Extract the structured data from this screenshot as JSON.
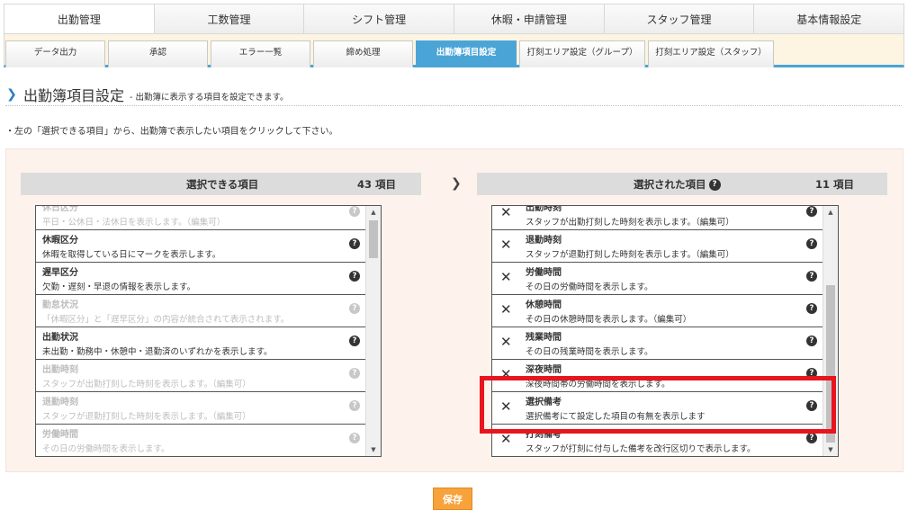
{
  "main_nav": [
    {
      "label": "出勤管理",
      "active": true
    },
    {
      "label": "工数管理"
    },
    {
      "label": "シフト管理"
    },
    {
      "label": "休暇・申請管理"
    },
    {
      "label": "スタッフ管理"
    },
    {
      "label": "基本情報設定"
    }
  ],
  "sub_nav": [
    {
      "label": "データ出力"
    },
    {
      "label": "承認"
    },
    {
      "label": "エラー一覧"
    },
    {
      "label": "締め処理"
    },
    {
      "label": "出勤簿項目設定",
      "active": true
    },
    {
      "label": "打刻エリア設定（グループ）"
    },
    {
      "label": "打刻エリア設定（スタッフ）"
    }
  ],
  "page": {
    "title": "出勤簿項目設定",
    "subtitle": "- 出勤簿に表示する項目を設定できます。",
    "instruction": "・左の「選択できる項目」から、出勤簿で表示したい項目をクリックして下さい。"
  },
  "available": {
    "title": "選択できる項目",
    "count": "43 項目",
    "items": [
      {
        "name": "休日区分",
        "desc": "平日・公休日・法休日を表示します。（編集可）",
        "disabled": true
      },
      {
        "name": "休暇区分",
        "desc": "休暇を取得している日にマークを表示します。",
        "disabled": false
      },
      {
        "name": "遅早区分",
        "desc": "欠勤・遅刻・早退の情報を表示します。",
        "disabled": false
      },
      {
        "name": "勤怠状況",
        "desc": "「休暇区分」と「遅早区分」の内容が統合されて表示されます。",
        "disabled": true
      },
      {
        "name": "出勤状況",
        "desc": "未出勤・勤務中・休憩中・退勤済のいずれかを表示します。",
        "disabled": false
      },
      {
        "name": "出勤時刻",
        "desc": "スタッフが出勤打刻した時刻を表示します。（編集可）",
        "disabled": true
      },
      {
        "name": "退勤時刻",
        "desc": "スタッフが退勤打刻した時刻を表示します。（編集可）",
        "disabled": true
      },
      {
        "name": "労働時間",
        "desc": "その日の労働時間を表示します。",
        "disabled": true
      }
    ]
  },
  "selected": {
    "title": "選択された項目",
    "count": "11 項目",
    "items": [
      {
        "name": "出勤時刻",
        "desc": "スタッフが出勤打刻した時刻を表示します。（編集可）"
      },
      {
        "name": "退勤時刻",
        "desc": "スタッフが退勤打刻した時刻を表示します。（編集可）"
      },
      {
        "name": "労働時間",
        "desc": "その日の労働時間を表示します。"
      },
      {
        "name": "休憩時間",
        "desc": "その日の休憩時間を表示します。（編集可）"
      },
      {
        "name": "残業時間",
        "desc": "その日の残業時間を表示します。"
      },
      {
        "name": "深夜時間",
        "desc": "深夜時間帯の労働時間を表示します。"
      },
      {
        "name": "選択備考",
        "desc": "選択備考にて設定した項目の有無を表示します"
      },
      {
        "name": "打刻備考",
        "desc": "スタッフが打刻に付与した備考を改行区切りで表示します。"
      }
    ]
  },
  "icons": {
    "help": "question-circle-icon",
    "remove": "close-icon",
    "arrow": "chevron-right-icon"
  },
  "colors": {
    "accent_blue": "#4aa5d6",
    "highlight_red": "#e8141e",
    "save_orange": "#f7a23a",
    "panel_bg": "#fdf3ec"
  },
  "save_label": "保存"
}
